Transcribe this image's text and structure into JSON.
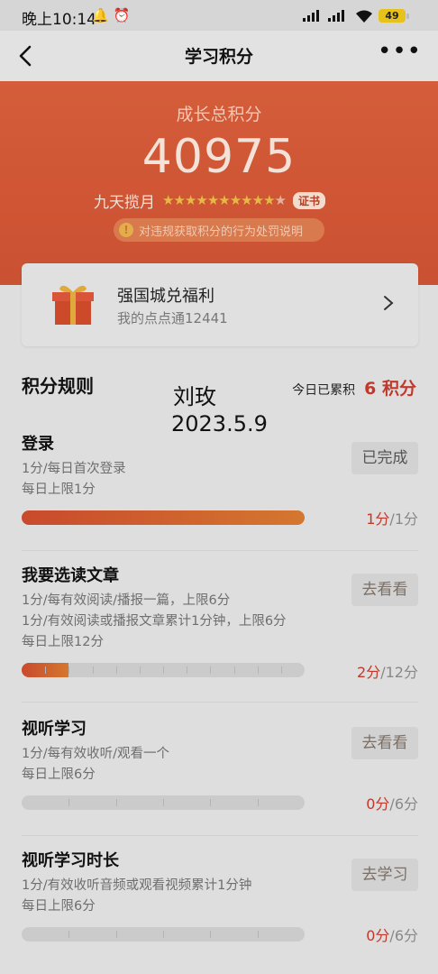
{
  "status": {
    "time": "晚上10:14",
    "battery": "49"
  },
  "nav": {
    "title": "学习积分"
  },
  "hero": {
    "label": "成长总积分",
    "score": "40975",
    "level": "九天揽月",
    "stars_filled": 10,
    "stars_total": 11,
    "cert": "证书",
    "notice": "对违规获取积分的行为处罚说明"
  },
  "card": {
    "title": "强国城兑福利",
    "subtitle": "我的点点通12441"
  },
  "rules": {
    "title": "积分规则",
    "today_label": "今日已累积",
    "today_value": "6 积分",
    "watermark_name": "刘玫",
    "watermark_date": "2023.5.9"
  },
  "tasks": [
    {
      "name": "登录",
      "desc": [
        "1分/每日首次登录",
        "每日上限1分"
      ],
      "button": "已完成",
      "earned": "1分",
      "limit": "/1分",
      "progress": 1.0,
      "segments": 1
    },
    {
      "name": "我要选读文章",
      "desc": [
        "1分/每有效阅读/播报一篇，上限6分",
        "1分/有效阅读或播报文章累计1分钟，上限6分",
        "每日上限12分"
      ],
      "button": "去看看",
      "earned": "2分",
      "limit": "/12分",
      "progress": 0.1667,
      "segments": 12
    },
    {
      "name": "视听学习",
      "desc": [
        "1分/每有效收听/观看一个",
        "每日上限6分"
      ],
      "button": "去看看",
      "earned": "0分",
      "limit": "/6分",
      "progress": 0,
      "segments": 6
    },
    {
      "name": "视听学习时长",
      "desc": [
        "1分/有效收听音频或观看视频累计1分钟",
        "每日上限6分"
      ],
      "button": "去学习",
      "earned": "0分",
      "limit": "/6分",
      "progress": 0,
      "segments": 6
    }
  ]
}
